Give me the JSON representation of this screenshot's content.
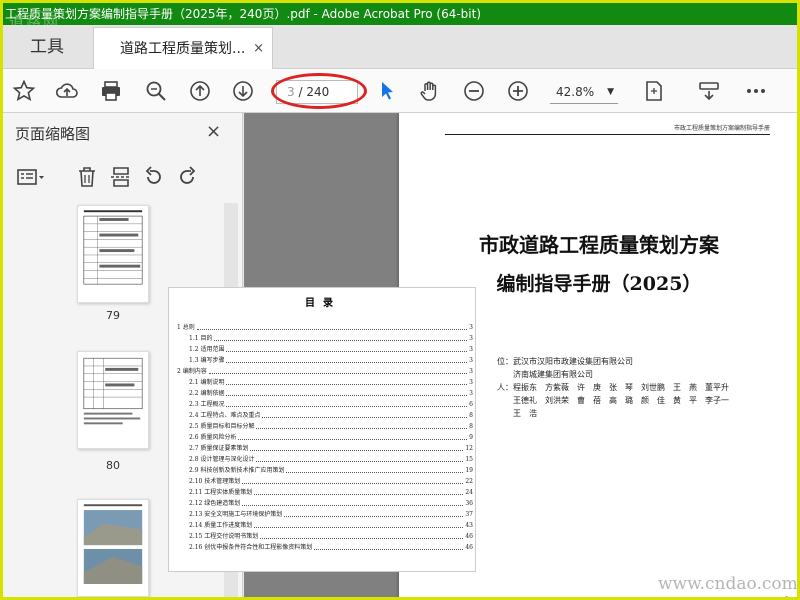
{
  "window": {
    "title": "工程质量策划方案编制指导手册（2025年，240页）.pdf - Adobe Acrobat Pro (64-bit)",
    "watermark_top": "道路网",
    "titlebar_color": "#128a12"
  },
  "tabs": {
    "tools_label": "工具",
    "doc_label": "道路工程质量策划...",
    "close_glyph": "×"
  },
  "toolbar": {
    "icons": [
      "star-icon",
      "cloud-upload-icon",
      "print-icon",
      "zoom-search-icon",
      "page-up-icon",
      "page-down-icon",
      "select-arrow-icon",
      "hand-tool-icon",
      "zoom-out-icon",
      "zoom-in-icon",
      "fit-page-icon",
      "scroll-mode-icon",
      "more-icon"
    ],
    "page_current": "3",
    "page_total": "/ 240",
    "zoom": "42.8%",
    "accent": "#1473e6",
    "highlight_color": "#d22222"
  },
  "sidepanel": {
    "title": "页面缩略图",
    "close_glyph": "×",
    "thumbs": [
      {
        "label": "79"
      },
      {
        "label": "80"
      },
      {
        "label": ""
      }
    ]
  },
  "page": {
    "header": "市政工程质量策划方案编制指导手册",
    "title_line1": "市政道路工程质量策划方案",
    "title_line2": "编制指导手册（2025）",
    "info": [
      "位：武汉市汉阳市政建设集团有限公司",
      "　　济南城建集团有限公司",
      "人：程振东　方紫薇　许　庚　张　琴　刘世鹏　王　燕　董平升",
      "　　王德礼　刘洪荣　曹　蓓　高　璐　颜　佳　黄　平　李子一",
      "　　王　浩"
    ],
    "page_no": "1"
  },
  "toc": {
    "title": "目录",
    "rows": [
      {
        "label": "1 总则",
        "page": "3",
        "sub": false
      },
      {
        "label": "1.1 目的",
        "page": "3",
        "sub": true
      },
      {
        "label": "1.2 适用范围",
        "page": "3",
        "sub": true
      },
      {
        "label": "1.3 编写步骤",
        "page": "3",
        "sub": true
      },
      {
        "label": "2 编制内容",
        "page": "3",
        "sub": false
      },
      {
        "label": "2.1 编制说明",
        "page": "3",
        "sub": true
      },
      {
        "label": "2.2 编制依据",
        "page": "3",
        "sub": true
      },
      {
        "label": "2.3 工程概况",
        "page": "6",
        "sub": true
      },
      {
        "label": "2.4 工程特点、难点及重点",
        "page": "8",
        "sub": true
      },
      {
        "label": "2.5 质量目标和目标分解",
        "page": "8",
        "sub": true
      },
      {
        "label": "2.6 质量风险分析",
        "page": "9",
        "sub": true
      },
      {
        "label": "2.7 质量保证要素策划",
        "page": "12",
        "sub": true
      },
      {
        "label": "2.8 设计管理与深化设计",
        "page": "15",
        "sub": true
      },
      {
        "label": "2.9 科技创新及新技术推广应用策划",
        "page": "19",
        "sub": true
      },
      {
        "label": "2.10 技术管理策划",
        "page": "22",
        "sub": true
      },
      {
        "label": "2.11 工程实体质量策划",
        "page": "24",
        "sub": true
      },
      {
        "label": "2.12 绿色建造策划",
        "page": "36",
        "sub": true
      },
      {
        "label": "2.13 安全文明施工与环境保护策划",
        "page": "37",
        "sub": true
      },
      {
        "label": "2.14 质量工作进度策划",
        "page": "43",
        "sub": true
      },
      {
        "label": "2.15 工程交付说明书策划",
        "page": "46",
        "sub": true
      },
      {
        "label": "2.16 创优申报条件符合性和工程影像资料策划",
        "page": "46",
        "sub": true
      }
    ]
  },
  "watermark_bottom": "www.cndao.com"
}
